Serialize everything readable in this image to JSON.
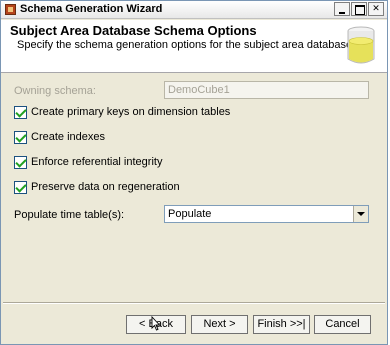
{
  "window": {
    "title": "Schema Generation Wizard"
  },
  "header": {
    "title": "Subject Area Database Schema Options",
    "subtitle": "Specify the schema generation options for the subject area database."
  },
  "form": {
    "owning_schema_label": "Owning schema:",
    "owning_schema_value": "DemoCube1",
    "checkboxes": [
      {
        "label": "Create primary keys on dimension tables",
        "checked": true
      },
      {
        "label": "Create indexes",
        "checked": true
      },
      {
        "label": "Enforce referential integrity",
        "checked": true
      },
      {
        "label": "Preserve data on regeneration",
        "checked": true
      }
    ],
    "populate_label": "Populate time table(s):",
    "populate_value": "Populate"
  },
  "buttons": {
    "back": "< Back",
    "next": "Next >",
    "finish": "Finish >>|",
    "cancel": "Cancel"
  }
}
